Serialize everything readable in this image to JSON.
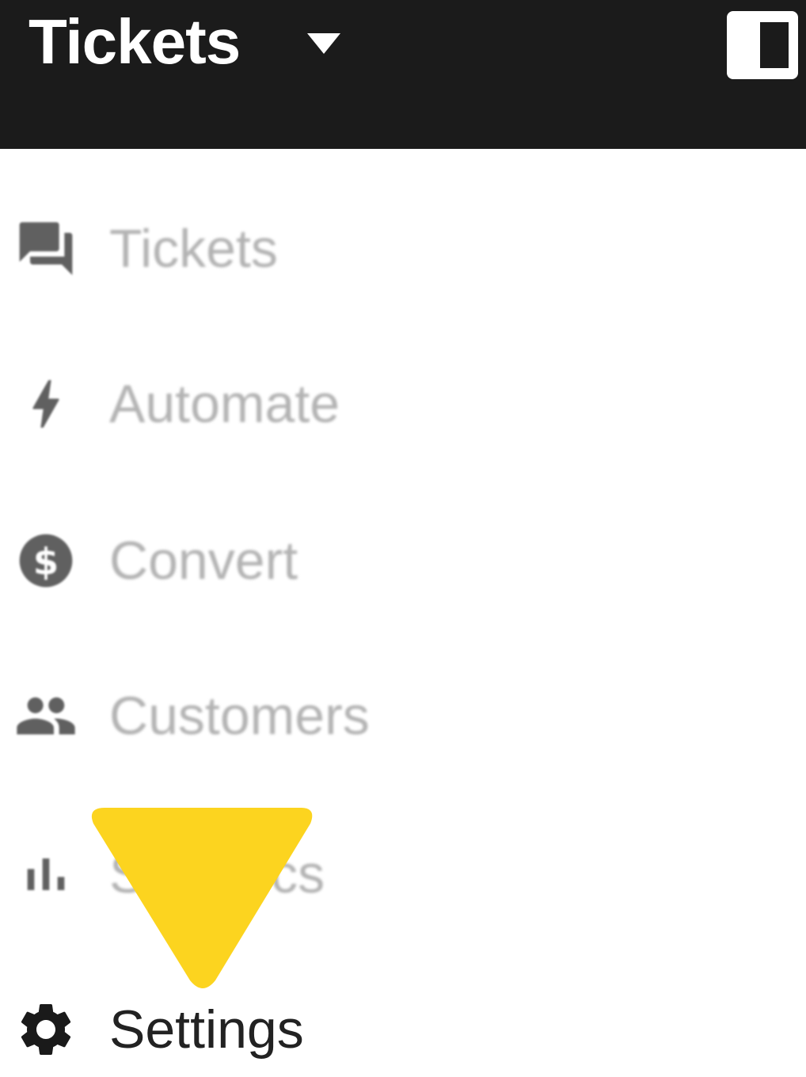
{
  "header": {
    "title": "Tickets",
    "dropdown_icon": "caret-down-icon",
    "panel_toggle_icon": "panel-toggle-icon",
    "background_color": "#1b1b1b"
  },
  "nav": {
    "items": [
      {
        "label": "Tickets",
        "icon": "chat-bubbles-icon",
        "state": "inactive"
      },
      {
        "label": "Automate",
        "icon": "lightning-icon",
        "state": "inactive"
      },
      {
        "label": "Convert",
        "icon": "dollar-coin-icon",
        "state": "inactive"
      },
      {
        "label": "Customers",
        "icon": "people-icon",
        "state": "inactive"
      },
      {
        "label": "Statistics",
        "icon": "bar-chart-icon",
        "state": "inactive"
      },
      {
        "label": "Settings",
        "icon": "gear-icon",
        "state": "highlighted"
      }
    ]
  },
  "annotation": {
    "shape": "triangle-pointer",
    "color": "#fcd41f"
  }
}
